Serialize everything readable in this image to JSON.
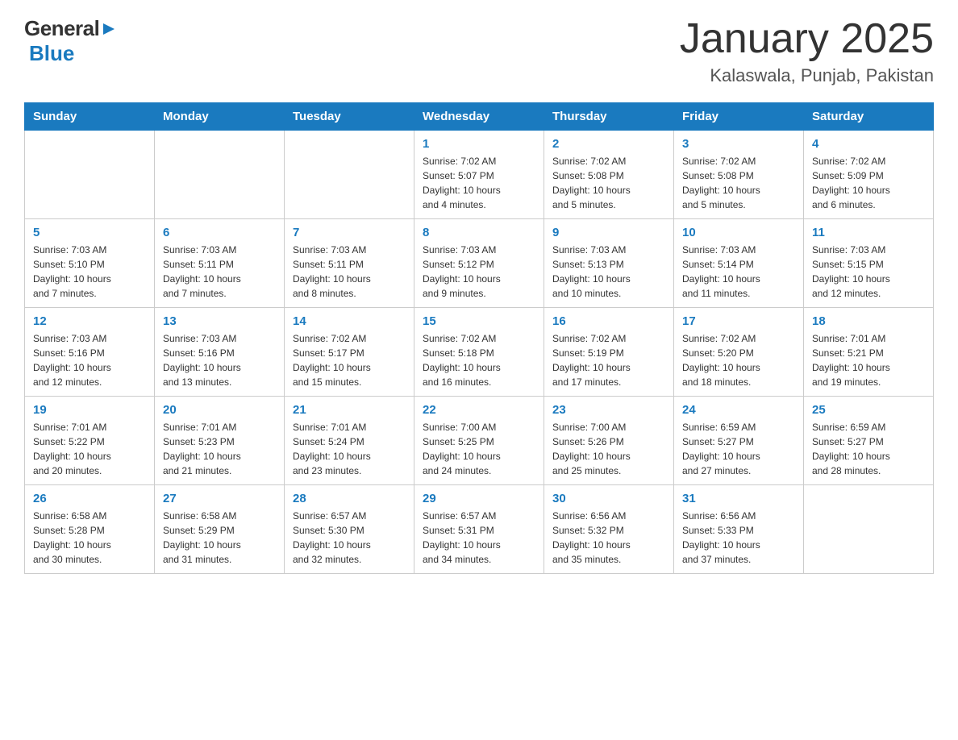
{
  "header": {
    "logo_general": "General",
    "logo_blue": "Blue",
    "month_title": "January 2025",
    "location": "Kalaswala, Punjab, Pakistan"
  },
  "days_of_week": [
    "Sunday",
    "Monday",
    "Tuesday",
    "Wednesday",
    "Thursday",
    "Friday",
    "Saturday"
  ],
  "weeks": [
    [
      {
        "day": "",
        "info": ""
      },
      {
        "day": "",
        "info": ""
      },
      {
        "day": "",
        "info": ""
      },
      {
        "day": "1",
        "info": "Sunrise: 7:02 AM\nSunset: 5:07 PM\nDaylight: 10 hours\nand 4 minutes."
      },
      {
        "day": "2",
        "info": "Sunrise: 7:02 AM\nSunset: 5:08 PM\nDaylight: 10 hours\nand 5 minutes."
      },
      {
        "day": "3",
        "info": "Sunrise: 7:02 AM\nSunset: 5:08 PM\nDaylight: 10 hours\nand 5 minutes."
      },
      {
        "day": "4",
        "info": "Sunrise: 7:02 AM\nSunset: 5:09 PM\nDaylight: 10 hours\nand 6 minutes."
      }
    ],
    [
      {
        "day": "5",
        "info": "Sunrise: 7:03 AM\nSunset: 5:10 PM\nDaylight: 10 hours\nand 7 minutes."
      },
      {
        "day": "6",
        "info": "Sunrise: 7:03 AM\nSunset: 5:11 PM\nDaylight: 10 hours\nand 7 minutes."
      },
      {
        "day": "7",
        "info": "Sunrise: 7:03 AM\nSunset: 5:11 PM\nDaylight: 10 hours\nand 8 minutes."
      },
      {
        "day": "8",
        "info": "Sunrise: 7:03 AM\nSunset: 5:12 PM\nDaylight: 10 hours\nand 9 minutes."
      },
      {
        "day": "9",
        "info": "Sunrise: 7:03 AM\nSunset: 5:13 PM\nDaylight: 10 hours\nand 10 minutes."
      },
      {
        "day": "10",
        "info": "Sunrise: 7:03 AM\nSunset: 5:14 PM\nDaylight: 10 hours\nand 11 minutes."
      },
      {
        "day": "11",
        "info": "Sunrise: 7:03 AM\nSunset: 5:15 PM\nDaylight: 10 hours\nand 12 minutes."
      }
    ],
    [
      {
        "day": "12",
        "info": "Sunrise: 7:03 AM\nSunset: 5:16 PM\nDaylight: 10 hours\nand 12 minutes."
      },
      {
        "day": "13",
        "info": "Sunrise: 7:03 AM\nSunset: 5:16 PM\nDaylight: 10 hours\nand 13 minutes."
      },
      {
        "day": "14",
        "info": "Sunrise: 7:02 AM\nSunset: 5:17 PM\nDaylight: 10 hours\nand 15 minutes."
      },
      {
        "day": "15",
        "info": "Sunrise: 7:02 AM\nSunset: 5:18 PM\nDaylight: 10 hours\nand 16 minutes."
      },
      {
        "day": "16",
        "info": "Sunrise: 7:02 AM\nSunset: 5:19 PM\nDaylight: 10 hours\nand 17 minutes."
      },
      {
        "day": "17",
        "info": "Sunrise: 7:02 AM\nSunset: 5:20 PM\nDaylight: 10 hours\nand 18 minutes."
      },
      {
        "day": "18",
        "info": "Sunrise: 7:01 AM\nSunset: 5:21 PM\nDaylight: 10 hours\nand 19 minutes."
      }
    ],
    [
      {
        "day": "19",
        "info": "Sunrise: 7:01 AM\nSunset: 5:22 PM\nDaylight: 10 hours\nand 20 minutes."
      },
      {
        "day": "20",
        "info": "Sunrise: 7:01 AM\nSunset: 5:23 PM\nDaylight: 10 hours\nand 21 minutes."
      },
      {
        "day": "21",
        "info": "Sunrise: 7:01 AM\nSunset: 5:24 PM\nDaylight: 10 hours\nand 23 minutes."
      },
      {
        "day": "22",
        "info": "Sunrise: 7:00 AM\nSunset: 5:25 PM\nDaylight: 10 hours\nand 24 minutes."
      },
      {
        "day": "23",
        "info": "Sunrise: 7:00 AM\nSunset: 5:26 PM\nDaylight: 10 hours\nand 25 minutes."
      },
      {
        "day": "24",
        "info": "Sunrise: 6:59 AM\nSunset: 5:27 PM\nDaylight: 10 hours\nand 27 minutes."
      },
      {
        "day": "25",
        "info": "Sunrise: 6:59 AM\nSunset: 5:27 PM\nDaylight: 10 hours\nand 28 minutes."
      }
    ],
    [
      {
        "day": "26",
        "info": "Sunrise: 6:58 AM\nSunset: 5:28 PM\nDaylight: 10 hours\nand 30 minutes."
      },
      {
        "day": "27",
        "info": "Sunrise: 6:58 AM\nSunset: 5:29 PM\nDaylight: 10 hours\nand 31 minutes."
      },
      {
        "day": "28",
        "info": "Sunrise: 6:57 AM\nSunset: 5:30 PM\nDaylight: 10 hours\nand 32 minutes."
      },
      {
        "day": "29",
        "info": "Sunrise: 6:57 AM\nSunset: 5:31 PM\nDaylight: 10 hours\nand 34 minutes."
      },
      {
        "day": "30",
        "info": "Sunrise: 6:56 AM\nSunset: 5:32 PM\nDaylight: 10 hours\nand 35 minutes."
      },
      {
        "day": "31",
        "info": "Sunrise: 6:56 AM\nSunset: 5:33 PM\nDaylight: 10 hours\nand 37 minutes."
      },
      {
        "day": "",
        "info": ""
      }
    ]
  ]
}
